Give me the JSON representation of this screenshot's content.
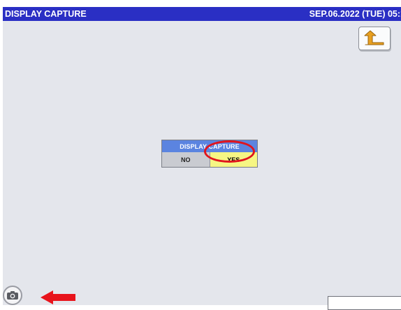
{
  "titlebar": {
    "title": "DISPLAY CAPTURE",
    "datetime": "SEP.06.2022 (TUE) 05:1"
  },
  "dialog": {
    "title": "DISPLAY CAPTURE",
    "no_label": "NO",
    "yes_label": "YES"
  },
  "icons": {
    "back": "return-arrow-icon",
    "capture": "camera-icon",
    "pointer": "red-arrow-left-icon"
  },
  "colors": {
    "titlebar": "#2a2fc4",
    "screen_background": "#e4e6ec",
    "dialog_title": "#5b84e0",
    "yes_button": "#f6f684",
    "highlight": "#e0141d",
    "back_icon": "#e8a020"
  }
}
